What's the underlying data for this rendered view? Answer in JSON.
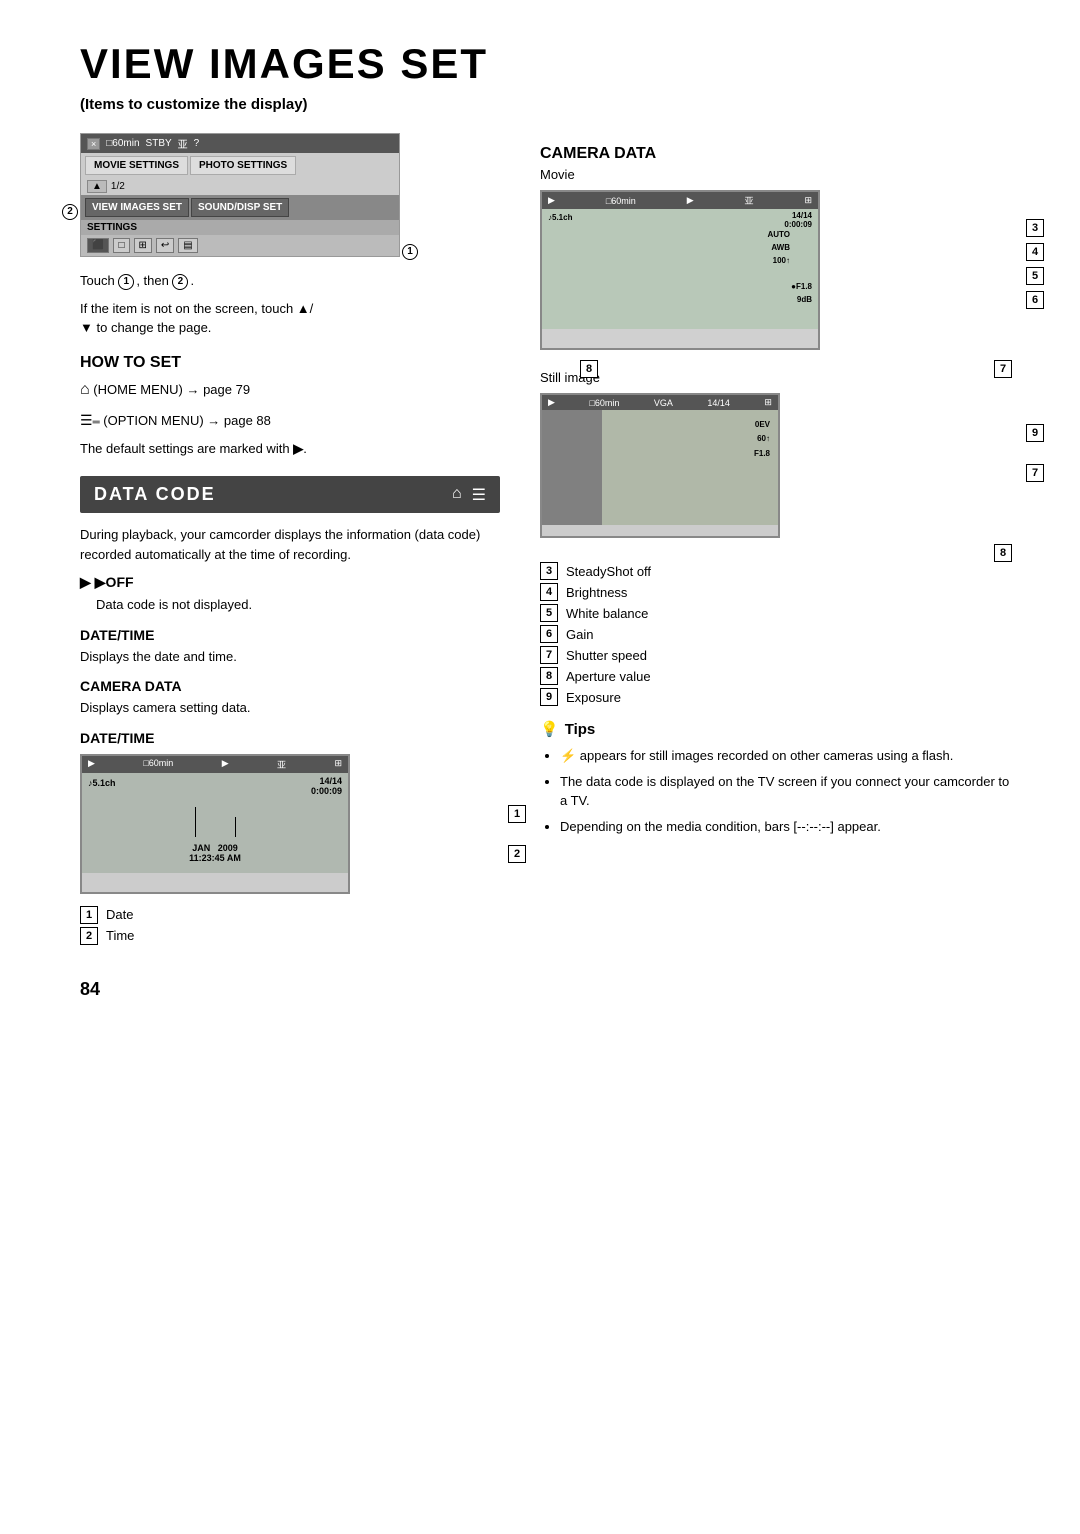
{
  "page": {
    "title": "VIEW IMAGES SET",
    "subtitle": "(Items to customize the display)",
    "page_number": "84"
  },
  "left_col": {
    "touch_instruction": "Touch",
    "touch_detail": ", then",
    "touch_note": "If the item is not on the screen, touch",
    "touch_note2": "to change the page.",
    "how_to_set_heading": "How to set",
    "home_menu_text": "(HOME MENU) → page 79",
    "option_menu_text": "(OPTION MENU) → page 88",
    "default_text": "The default settings are marked with",
    "data_code_banner": "DATA CODE",
    "data_code_body": "During playback, your camcorder displays the information (data code) recorded automatically at the time of recording.",
    "off_heading": "▶OFF",
    "off_body": "Data code is not displayed.",
    "datetime_heading": "DATE/TIME",
    "datetime_body": "Displays the date and time.",
    "camera_data_heading": "CAMERA DATA",
    "camera_data_body": "Displays camera setting data.",
    "datetime2_heading": "DATE/TIME",
    "date_label": "Date",
    "time_label": "Time"
  },
  "menu_mockup": {
    "top_bar_items": [
      "×",
      "□60min",
      "STBY",
      "亚",
      "?"
    ],
    "row1_buttons": [
      "MOVIE SETTINGS",
      "PHOTO SETTINGS"
    ],
    "page_indicator": "1/2",
    "row2_buttons": [
      "VIEW IMAGES SET",
      "SOUND/DISP SET"
    ],
    "settings_label": "SETTINGS",
    "icon_row": [
      "⬛",
      "□",
      "⊞",
      "↩",
      "▤"
    ],
    "callout1": "①",
    "callout2": "②"
  },
  "dt_screen": {
    "top_items": [
      "▶",
      "□60min",
      "▶",
      "亚",
      "⊞"
    ],
    "info_left": "♪5.1ch",
    "info_right": "14/14\n0:00:09",
    "date_display": "JAN  2009\n11:23:45 AM",
    "callout1": "1",
    "callout2": "2"
  },
  "right_col": {
    "camera_data_heading": "CAMERA DATA",
    "movie_label": "Movie",
    "still_label": "Still image"
  },
  "movie_screen": {
    "top_items": [
      "▶",
      "□60min",
      "▶",
      "亚",
      "⊞"
    ],
    "info_left": "♪5.1ch",
    "info_right": "14/14\n0:00:09",
    "overlay_items": [
      "100↑",
      "AWB",
      "●F1.8",
      "9dB"
    ],
    "callouts": [
      "3",
      "4",
      "5",
      "6",
      "7",
      "8"
    ]
  },
  "still_screen": {
    "top_items": [
      "▶",
      "□60min",
      "VGA",
      "14/14",
      "⊞"
    ],
    "overlay_items": [
      "0EV",
      "60↑",
      "F1.8"
    ],
    "callouts": [
      "9",
      "7",
      "8"
    ]
  },
  "legend": {
    "items": [
      {
        "num": "3",
        "text": "SteadyShot off"
      },
      {
        "num": "4",
        "text": "Brightness"
      },
      {
        "num": "5",
        "text": "White balance"
      },
      {
        "num": "6",
        "text": "Gain"
      },
      {
        "num": "7",
        "text": "Shutter speed"
      },
      {
        "num": "8",
        "text": "Aperture value"
      },
      {
        "num": "9",
        "text": "Exposure"
      }
    ]
  },
  "tips": {
    "heading": "Tips",
    "items": [
      "⚡ appears for still images recorded on other cameras using a flash.",
      "The data code is displayed on the TV screen if you connect your camcorder to a TV.",
      "Depending on the media condition, bars [--:--:--] appear."
    ]
  }
}
